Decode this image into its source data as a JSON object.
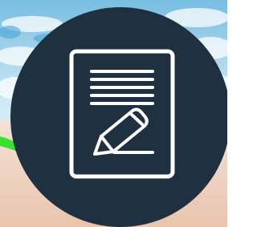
{
  "colors": {
    "circle_fill": "#1f3140",
    "icon_stroke": "#ffffff",
    "sky_blue": "#8cc9e8",
    "water_light": "#d6eef9",
    "sand": "#f2dccb",
    "green_accent": "#39e22b"
  },
  "icons": {
    "badge": "document-edit-icon",
    "pencil": "pencil-icon"
  }
}
